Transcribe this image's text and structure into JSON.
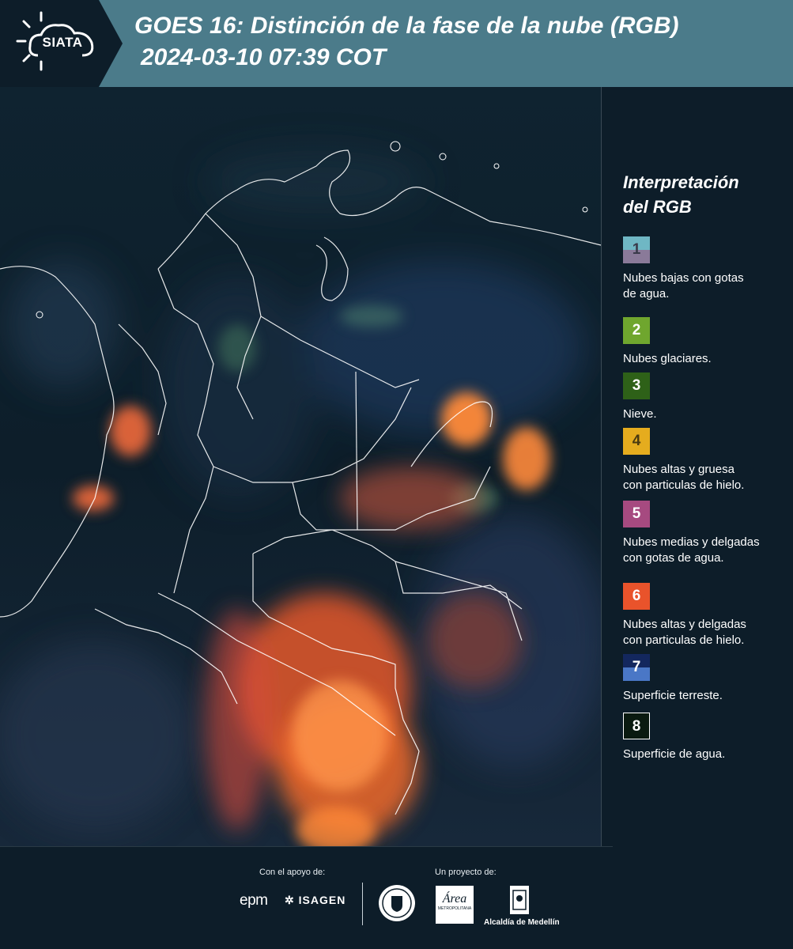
{
  "header": {
    "logo_text": "SIATA",
    "title_line1": "GOES 16: Distinción de la fase de la nube (RGB)",
    "title_line2": "2024-03-10 07:39 COT"
  },
  "legend": {
    "title_line1": "Interpretación",
    "title_line2": "del RGB",
    "items": [
      {
        "number": "1",
        "label_line1": "Nubes bajas con gotas",
        "label_line2": "de agua.",
        "color_top": "#6fb7c4",
        "color_bottom": "#8a7a99",
        "text_color": "#3a3a4a"
      },
      {
        "number": "2",
        "label_line1": "Nubes glaciares.",
        "label_line2": "",
        "color_top": "#6fa62e",
        "color_bottom": "#6fa62e",
        "text_color": "#ffffff"
      },
      {
        "number": "3",
        "label_line1": "Nieve.",
        "label_line2": "",
        "color_top": "#2e6118",
        "color_bottom": "#2e6118",
        "text_color": "#ffffff"
      },
      {
        "number": "4",
        "label_line1": "Nubes altas y gruesa",
        "label_line2": "con particulas de hielo.",
        "color_top": "#e5ac1e",
        "color_bottom": "#e5ac1e",
        "text_color": "#4a3a10"
      },
      {
        "number": "5",
        "label_line1": "Nubes medias y delgadas",
        "label_line2": "con gotas de agua.",
        "color_top": "#a64a80",
        "color_bottom": "#a64a80",
        "text_color": "#ffffff"
      },
      {
        "number": "6",
        "label_line1": "Nubes altas y delgadas",
        "label_line2": "con particulas de hielo.",
        "color_top": "#e9532b",
        "color_bottom": "#e9532b",
        "text_color": "#ffffff"
      },
      {
        "number": "7",
        "label_line1": "Superficie terreste.",
        "label_line2": "",
        "color_top": "#13275e",
        "color_bottom": "#4a77c6",
        "text_color": "#ffffff"
      },
      {
        "number": "8",
        "label_line1": "Superficie de agua.",
        "label_line2": "",
        "color_top": "#0a1a10",
        "color_bottom": "#0a1a10",
        "text_color": "#ffffff"
      }
    ]
  },
  "footer": {
    "support_label": "Con el apoyo de:",
    "project_label": "Un proyecto de:",
    "epm": "epm",
    "isagen": "ISAGEN",
    "alcaldia": "Alcaldía de Medellín",
    "area_text": "Área",
    "area_sub": "METROPOLITANA"
  }
}
